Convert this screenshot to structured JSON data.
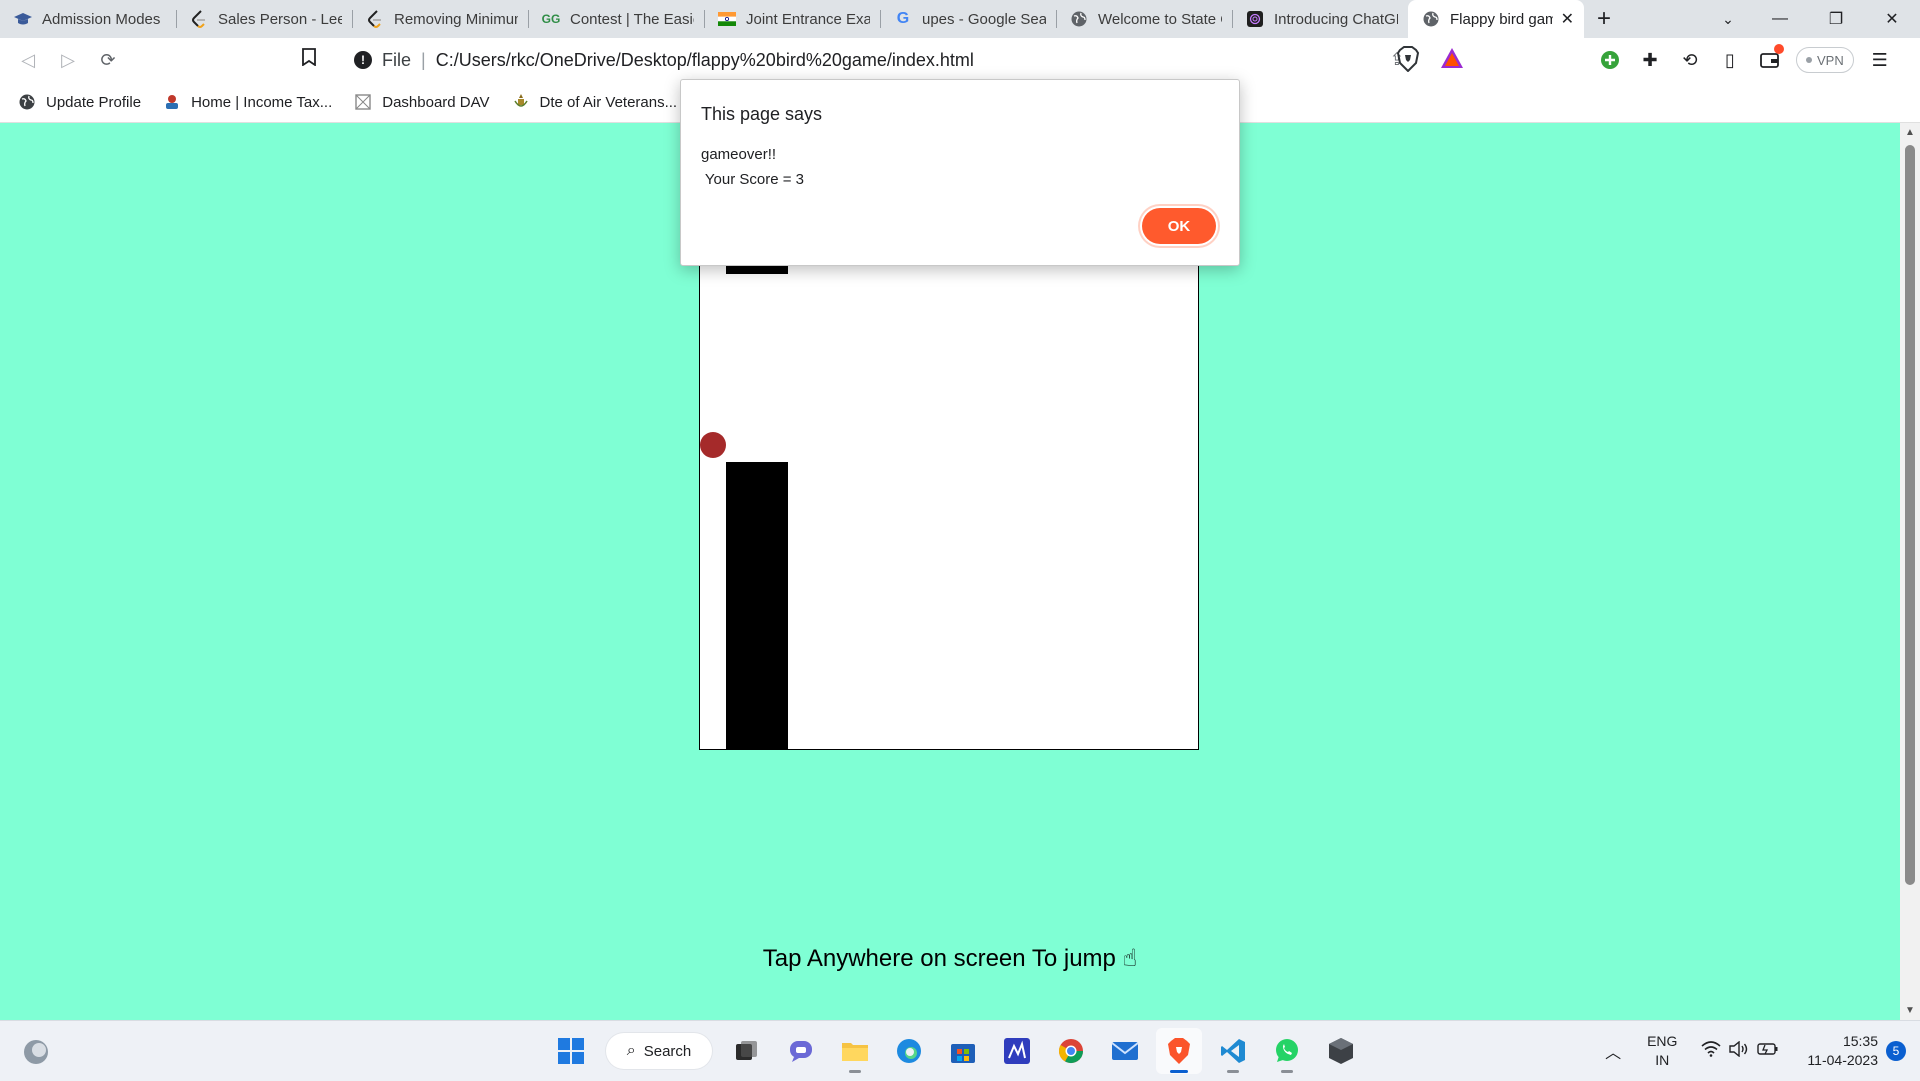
{
  "browser": {
    "tabs": [
      {
        "title": "Admission Modes",
        "icon": "cap-icon"
      },
      {
        "title": "Sales Person - LeetC",
        "icon": "leetcode-icon"
      },
      {
        "title": "Removing Minimum",
        "icon": "leetcode-icon"
      },
      {
        "title": "Contest | The Easies",
        "icon": "gfg-icon"
      },
      {
        "title": "Joint Entrance Exam",
        "icon": "india-flag-icon"
      },
      {
        "title": "upes - Google Sear",
        "icon": "google-icon"
      },
      {
        "title": "Welcome to State C",
        "icon": "globe-icon"
      },
      {
        "title": "Introducing ChatGP",
        "icon": "chatgpt-icon"
      },
      {
        "title": "Flappy bird gam",
        "icon": "globe-icon",
        "active": true
      }
    ],
    "address": {
      "scheme": "File",
      "url": "C:/Users/rkc/OneDrive/Desktop/flappy%20bird%20game/index.html"
    },
    "vpn_label": "VPN",
    "bookmarks": [
      {
        "label": "Update Profile",
        "icon": "globe-icon"
      },
      {
        "label": "Home | Income Tax...",
        "icon": "income-tax-icon"
      },
      {
        "label": "Dashboard DAV",
        "icon": "dashboard-icon"
      },
      {
        "label": "Dte of Air Veterans...",
        "icon": "emblem-icon"
      }
    ]
  },
  "dialog": {
    "title": "This page says",
    "message": "gameover!!\n Your Score = 3",
    "ok_label": "OK"
  },
  "game": {
    "instruction": "Tap Anywhere on screen To jump  ☝",
    "background_color": "#7fffd4",
    "bird_color": "#a52a2a"
  },
  "taskbar": {
    "search_label": "Search",
    "lang_line1": "ENG",
    "lang_line2": "IN",
    "time": "15:35",
    "date": "11-04-2023",
    "notification_count": "5"
  },
  "colors": {
    "accent_ok": "#ff5a2d",
    "taskbar_active": "#0a5fd0"
  }
}
